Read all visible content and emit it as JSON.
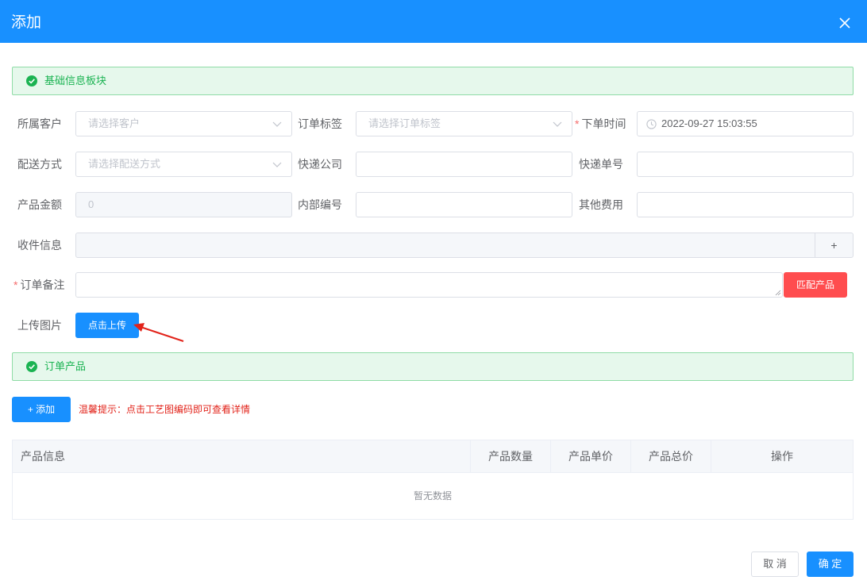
{
  "dialog": {
    "title": "添加"
  },
  "sections": {
    "basic": "基础信息板块",
    "products": "订单产品"
  },
  "form": {
    "customer": {
      "label": "所属客户",
      "placeholder": "请选择客户"
    },
    "order_tag": {
      "label": "订单标签",
      "placeholder": "请选择订单标签"
    },
    "order_time": {
      "required_mark": "*",
      "label": "下单时间",
      "value": "2022-09-27 15:03:55"
    },
    "delivery": {
      "label": "配送方式",
      "placeholder": "请选择配送方式"
    },
    "courier_company": {
      "label": "快递公司",
      "value": ""
    },
    "tracking_no": {
      "label": "快递单号",
      "value": ""
    },
    "product_amount": {
      "label": "产品金额",
      "value": "0"
    },
    "internal_no": {
      "label": "内部编号",
      "value": ""
    },
    "other_fees": {
      "label": "其他费用",
      "value": ""
    },
    "receiver_info": {
      "label": "收件信息",
      "value": "",
      "add_symbol": "+"
    },
    "order_remark": {
      "required_mark": "*",
      "label": "订单备注",
      "value": ""
    },
    "match_button": "匹配产品",
    "upload": {
      "label": "上传图片",
      "button": "点击上传"
    }
  },
  "products": {
    "add_button": "+ 添加",
    "tip": "温馨提示：点击工艺图编码即可查看详情",
    "table": {
      "columns": [
        "产品信息",
        "产品数量",
        "产品单价",
        "产品总价",
        "操作"
      ],
      "empty_text": "暂无数据"
    }
  },
  "footer": {
    "cancel": "取 消",
    "confirm": "确 定"
  },
  "colors": {
    "primary": "#1890ff",
    "danger": "#ff4d4f",
    "success": "#1bb352",
    "required": "#f56c6c",
    "tip": "#e2231a"
  },
  "icons": {
    "close": "close-icon",
    "check": "check-circle-icon",
    "chevron": "chevron-down-icon",
    "clock": "clock-icon",
    "annotation": "red-arrow-annotation"
  }
}
